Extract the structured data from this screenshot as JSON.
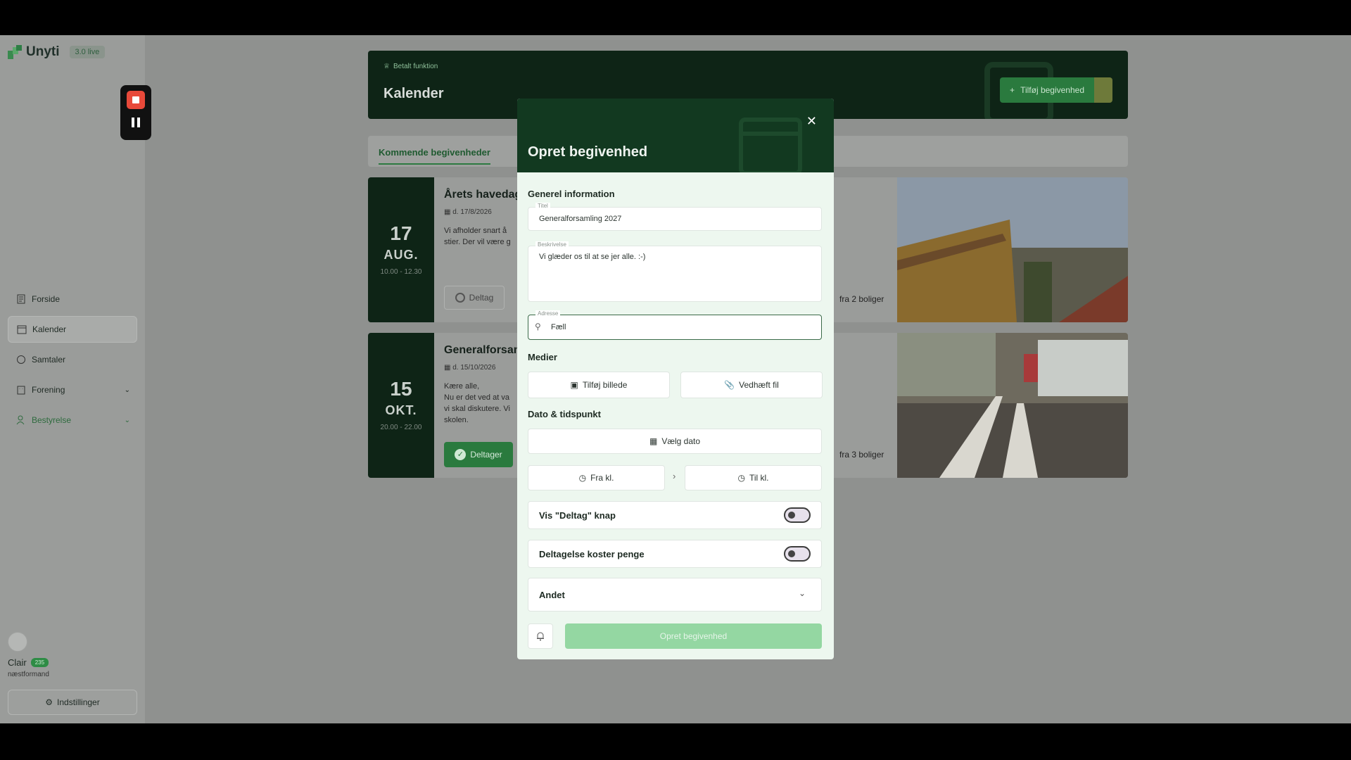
{
  "sidebar": {
    "app_name": "Unyti",
    "version": "3.0 live",
    "items": [
      {
        "label": "Forside"
      },
      {
        "label": "Kalender"
      },
      {
        "label": "Samtaler"
      },
      {
        "label": "Forening"
      },
      {
        "label": "Bestyrelse"
      }
    ],
    "user": {
      "name": "Clair",
      "badge": "235",
      "role": "næstformand"
    },
    "settings_label": "Indstillinger"
  },
  "header": {
    "paid_label": "Betalt funktion",
    "title": "Kalender",
    "add_event_label": "Tilføj begivenhed"
  },
  "tabs": {
    "upcoming": "Kommende begivenheder"
  },
  "events": [
    {
      "day": "17",
      "month": "AUG.",
      "time": "10.00 - 12.30",
      "title": "Årets havedag",
      "date": "d. 17/8/2026",
      "desc_line1": "Vi afholder snart å",
      "desc_line2": "stier. Der vil være g",
      "button": "Deltag",
      "count": "fra 2 boliger"
    },
    {
      "day": "15",
      "month": "OKT.",
      "time": "20.00 - 22.00",
      "title": "Generalforsam",
      "date": "d. 15/10/2026",
      "desc_line1": "Kære alle,",
      "desc_line2": "Nu er det ved at va",
      "desc_line3": "vi skal diskutere. Vi",
      "desc_line4": "skolen.",
      "button": "Deltager",
      "count": "fra 3 boliger"
    }
  ],
  "modal": {
    "title": "Opret begivenhed",
    "general_section": "Generel information",
    "title_label": "Titel",
    "title_value": "Generalforsamling 2027",
    "desc_label": "Beskrivelse",
    "desc_value": "Vi glæder os til at se jer alle. :-)",
    "address_label": "Adresse",
    "address_value": "Fæll",
    "media_section": "Medier",
    "add_image": "Tilføj billede",
    "attach_file": "Vedhæft fil",
    "datetime_section": "Dato & tidspunkt",
    "choose_date": "Vælg dato",
    "from_time": "Fra kl.",
    "to_time": "Til kl.",
    "show_join_toggle": "Vis \"Deltag\" knap",
    "costs_money_toggle": "Deltagelse koster penge",
    "other_section": "Andet",
    "submit": "Opret begivenhed"
  },
  "colors": {
    "brand_dark": "#123920",
    "brand_green": "#2a7a3e",
    "submit_disabled": "#94d7a2"
  }
}
